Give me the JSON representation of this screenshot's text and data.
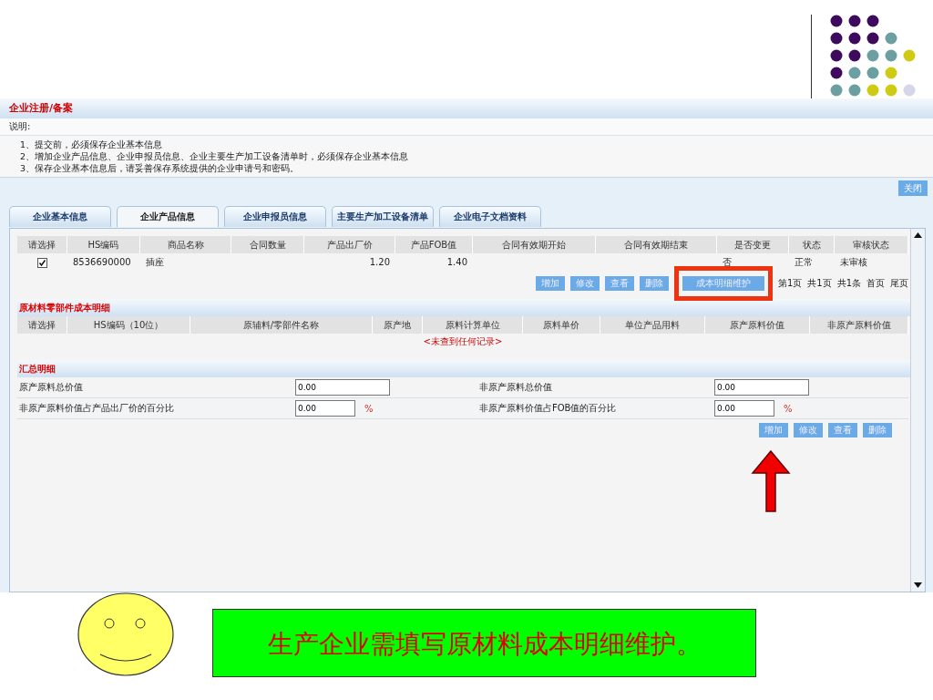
{
  "page_title": "企业注册/备案",
  "notes_label": "说明:",
  "notes": [
    "1、提交前，必须保存企业基本信息",
    "2、增加企业产品信息、企业申报员信息、企业主要生产加工设备清单时，必须保存企业基本信息",
    "3、保存企业基本信息后，请妥善保存系统提供的企业申请号和密码。"
  ],
  "close_button": "关闭",
  "tabs": [
    {
      "label": "企业基本信息",
      "selected": false
    },
    {
      "label": "企业产品信息",
      "selected": true
    },
    {
      "label": "企业申报员信息",
      "selected": false
    },
    {
      "label": "主要生产加工设备清单",
      "selected": false
    },
    {
      "label": "企业电子文档资料",
      "selected": false
    }
  ],
  "product_table": {
    "columns": [
      "请选择",
      "HS编码",
      "商品名称",
      "合同数量",
      "产品出厂价",
      "产品FOB值",
      "合同有效期开始",
      "合同有效期结束",
      "是否变更",
      "状态",
      "审核状态"
    ],
    "rows": [
      {
        "checked": true,
        "cells": [
          "",
          "8536690000",
          "插座",
          "",
          "1.20",
          "1.40",
          "",
          "",
          "否",
          "正常",
          "未审核"
        ]
      }
    ]
  },
  "product_buttons": [
    "增加",
    "修改",
    "查看",
    "删除"
  ],
  "cost_button": "成本明细维护",
  "pager": [
    "第1页",
    "共1页",
    "共1条",
    "首页",
    "尾页"
  ],
  "materials": {
    "title": "原材料零部件成本明细",
    "columns": [
      "请选择",
      "HS编码（10位）",
      "原辅料/零部件名称",
      "原产地",
      "原料计算单位",
      "原料单价",
      "单位产品用料",
      "原产原料价值",
      "非原产原料价值"
    ],
    "empty": "<未查到任何记录>"
  },
  "summary": {
    "title": "汇总明细",
    "rows": [
      {
        "label": "原产原料总价值",
        "value": "0.00",
        "unit": "",
        "label_2": "非原产原料总价值",
        "value_2": "0.00",
        "unit_2": ""
      },
      {
        "label": "非原产原料价值占产品出厂价的百分比",
        "value": "0.00",
        "unit": "%",
        "label_2": "非原产原料价值占FOB值的百分比",
        "value_2": "0.00",
        "unit_2": "%"
      }
    ]
  },
  "summary_buttons": [
    "增加",
    "修改",
    "查看",
    "删除"
  ],
  "caption": "生产企业需填写原材料成本明细维护。"
}
